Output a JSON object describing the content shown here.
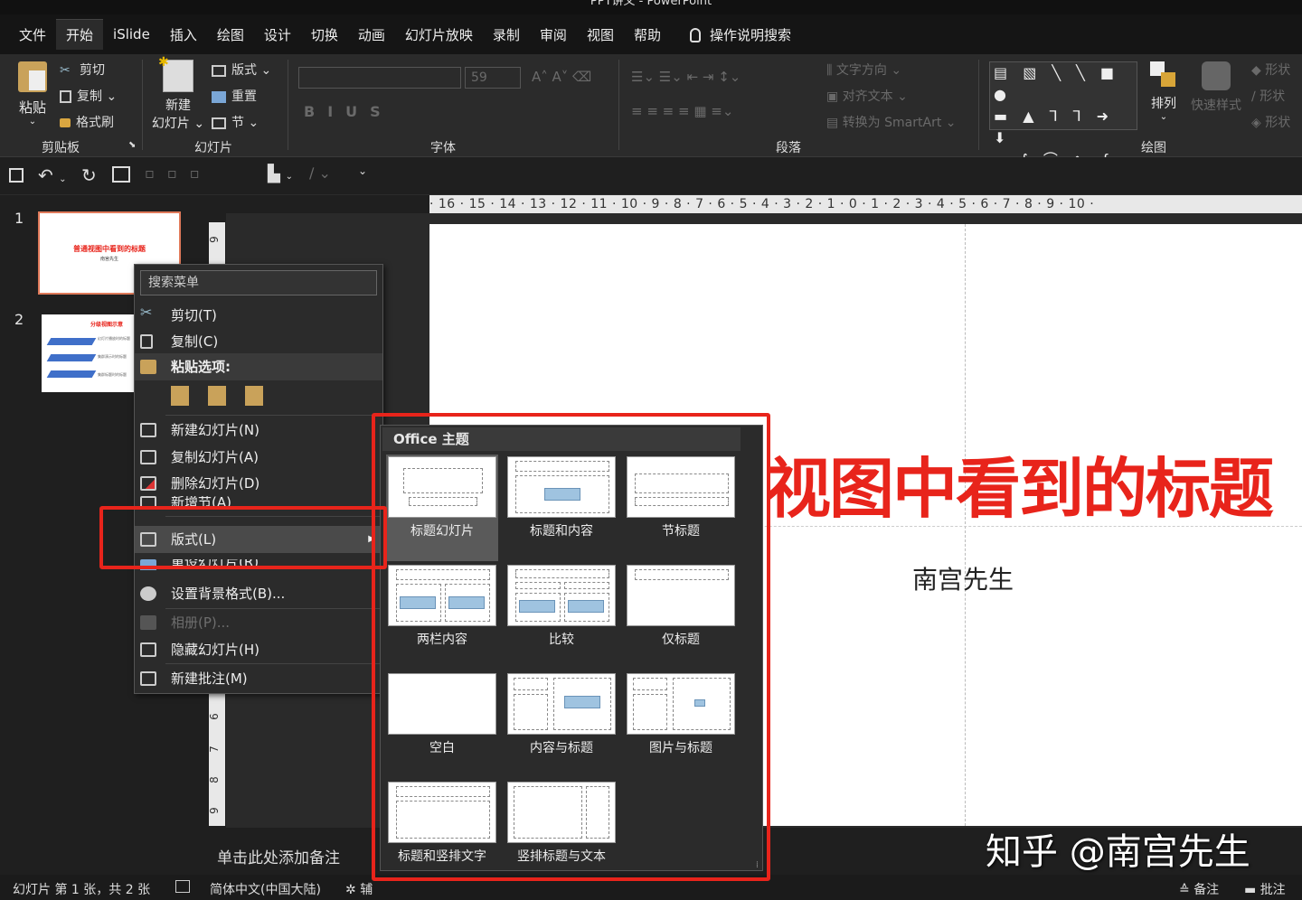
{
  "app": {
    "title": "PPT讲义 - PowerPoint"
  },
  "menubar": {
    "tabs": [
      "文件",
      "开始",
      "iSlide",
      "插入",
      "绘图",
      "设计",
      "切换",
      "动画",
      "幻灯片放映",
      "录制",
      "审阅",
      "视图",
      "帮助"
    ],
    "active": "开始",
    "tell_me": "操作说明搜索"
  },
  "ribbon": {
    "clipboard": {
      "paste": "粘贴",
      "cut": "剪切",
      "copy": "复制",
      "format_painter": "格式刷",
      "group": "剪贴板"
    },
    "slides": {
      "new_slide_1": "新建",
      "new_slide_2": "幻灯片",
      "layout": "版式",
      "reset": "重置",
      "section": "节",
      "group": "幻灯片"
    },
    "font": {
      "size": "59",
      "group": "字体"
    },
    "paragraph": {
      "text_direction": "文字方向",
      "align_text": "对齐文本",
      "smartart": "转换为 SmartArt",
      "group": "段落"
    },
    "drawing": {
      "arrange": "排列",
      "quick_styles": "快速样式",
      "shape_fill": "形状",
      "shape_outline": "形状",
      "shape_effects": "形状",
      "group": "绘图"
    }
  },
  "thumbnails": [
    {
      "number": "1",
      "title": "普通视图中看到的标题",
      "subtitle": "南宫先生"
    },
    {
      "number": "2",
      "title": "分级视图示意",
      "lines": [
        "幻灯片播放时的标题",
        "集群演示时的标题",
        "集群标题时的标题"
      ]
    }
  ],
  "context_menu": {
    "search_placeholder": "搜索菜单",
    "items": [
      "剪切(T)",
      "复制(C)",
      "粘贴选项:",
      "新建幻灯片(N)",
      "复制幻灯片(A)",
      "删除幻灯片(D)",
      "新增节(A)",
      "版式(L)",
      "重设幻灯片(R)",
      "设置背景格式(B)...",
      "相册(P)...",
      "隐藏幻灯片(H)",
      "新建批注(M)"
    ]
  },
  "layout_gallery": {
    "header": "Office 主题",
    "layouts": [
      "标题幻灯片",
      "标题和内容",
      "节标题",
      "两栏内容",
      "比较",
      "仅标题",
      "空白",
      "内容与标题",
      "图片与标题",
      "标题和竖排文字",
      "竖排标题与文本"
    ],
    "selected": "标题幻灯片"
  },
  "slide": {
    "title": "视图中看到的标题",
    "subtitle": "南宫先生"
  },
  "ruler": {
    "horizontal": "· 16 · 15 · 14 · 13 · 12 · 11 · 10 · 9 · 8 · 7 · 6 · 5 · 4 · 3 · 2 · 1 · 0 · 1 · 2 · 3 · 4 · 5 · 6 · 7 · 8 · 9 · 10 ·",
    "vertical_top": "9",
    "vertical_bottom": [
      "6",
      "7",
      "8",
      "9"
    ]
  },
  "notes": {
    "placeholder": "单击此处添加备注"
  },
  "watermark": "知乎 @南宫先生",
  "statusbar": {
    "slide_info": "幻灯片 第 1 张，共 2 张",
    "language": "简体中文(中国大陆)",
    "accessibility": "辅",
    "notes": "备注",
    "comments": "批注"
  },
  "colors": {
    "highlight_red": "#e8241b",
    "title_red": "#e8241b"
  }
}
